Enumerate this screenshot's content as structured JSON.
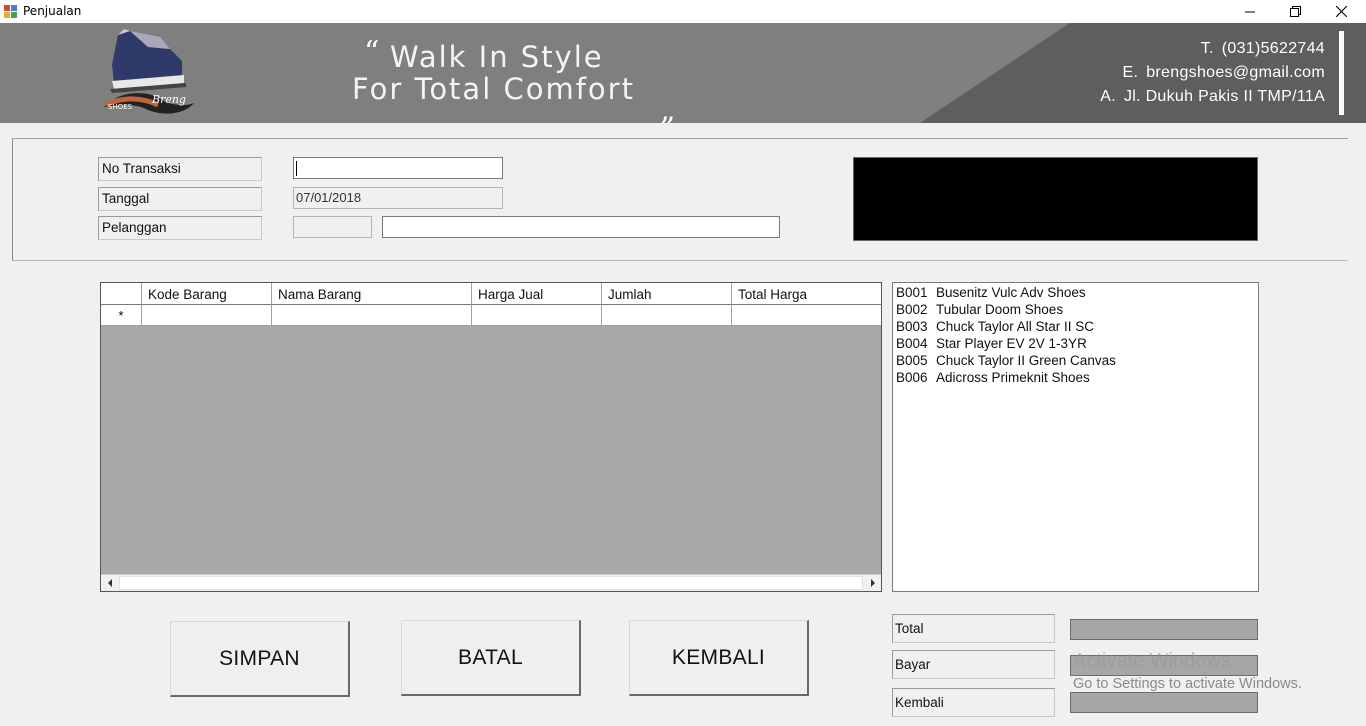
{
  "window": {
    "title": "Penjualan",
    "minimize_icon": "minimize-icon",
    "restore_icon": "restore-icon",
    "close_icon": "close-icon"
  },
  "banner": {
    "logo_text_shoes": "SHOES",
    "logo_text_breng": "Breng",
    "quote_open": "“",
    "quote_close": "„",
    "slogan_line1": "Walk In Style",
    "slogan_line2": "For Total Comfort",
    "contact": [
      {
        "prefix": "T.",
        "value": "(031)5622744"
      },
      {
        "prefix": "E.",
        "value": "brengshoes@gmail.com"
      },
      {
        "prefix": "A.",
        "value": "Jl. Dukuh Pakis II TMP/11A"
      }
    ],
    "colors": {
      "light": "#7f7f7f",
      "dark": "#5e5e5e"
    }
  },
  "form": {
    "no_transaksi_label": "No Transaksi",
    "no_transaksi_value": "",
    "tanggal_label": "Tanggal",
    "tanggal_value": "07/01/2018",
    "pelanggan_label": "Pelanggan",
    "pelanggan_code": "",
    "pelanggan_name": ""
  },
  "grid": {
    "columns": [
      "Kode Barang",
      "Nama Barang",
      "Harga Jual",
      "Jumlah",
      "Total Harga"
    ],
    "new_row_marker": "*",
    "rows": []
  },
  "products": [
    {
      "code": "B001",
      "name": "Busenitz Vulc Adv Shoes"
    },
    {
      "code": "B002",
      "name": "Tubular Doom Shoes"
    },
    {
      "code": "B003",
      "name": "Chuck Taylor All Star II SC"
    },
    {
      "code": "B004",
      "name": "Star Player EV 2V 1-3YR"
    },
    {
      "code": "B005",
      "name": "Chuck Taylor II Green Canvas"
    },
    {
      "code": "B006",
      "name": "Adicross Primeknit Shoes"
    }
  ],
  "buttons": {
    "simpan": "SIMPAN",
    "batal": "BATAL",
    "kembali": "KEMBALI"
  },
  "totals": {
    "total_label": "Total",
    "total_value": "",
    "bayar_label": "Bayar",
    "bayar_value": "",
    "kembali_label": "Kembali",
    "kembali_value": ""
  },
  "watermark": {
    "line1": "Activate Windows",
    "line2": "Go to Settings to activate Windows."
  }
}
